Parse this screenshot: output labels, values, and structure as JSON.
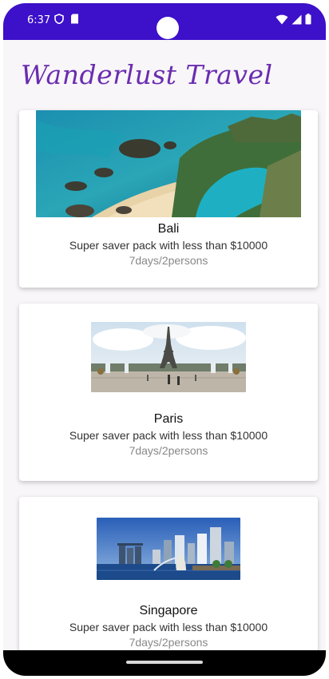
{
  "status_bar": {
    "time": "6:37",
    "icons": [
      "shield-icon",
      "sd-card-icon",
      "wifi-icon",
      "signal-icon",
      "battery-icon"
    ]
  },
  "app": {
    "title": "Wanderlust Travel",
    "accent_color": "#3d10c9",
    "title_color": "#6a2cb0"
  },
  "packages": [
    {
      "destination": "Bali",
      "description": "Super saver pack with less than $10000",
      "duration": "7days/2persons"
    },
    {
      "destination": "Paris",
      "description": "Super saver pack with less than $10000",
      "duration": "7days/2persons"
    },
    {
      "destination": "Singapore",
      "description": "Super saver pack with less than $10000",
      "duration": "7days/2persons"
    }
  ]
}
